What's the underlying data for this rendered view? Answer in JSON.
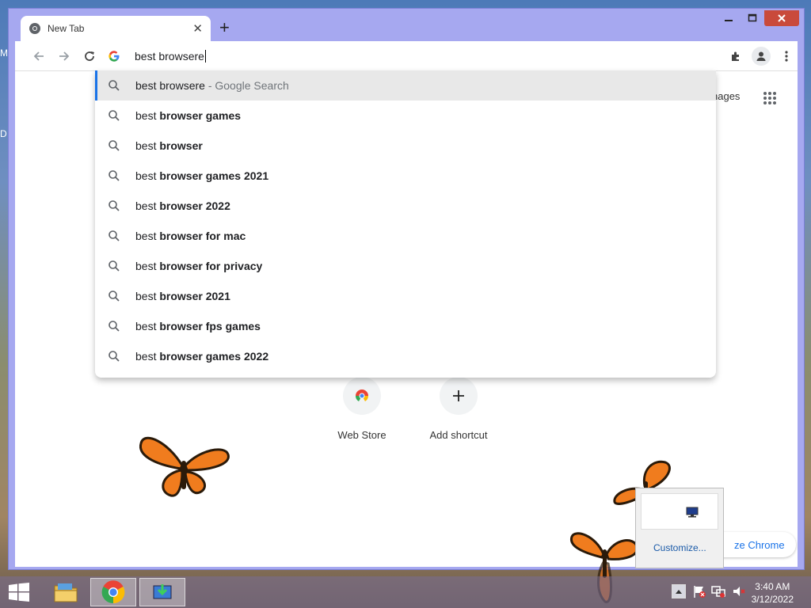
{
  "browser": {
    "tab": {
      "title": "New Tab"
    },
    "omnibox": {
      "value": "best browsere"
    },
    "suggestions": [
      {
        "prefix": "best browsere",
        "bold": "",
        "secondary": " - Google Search"
      },
      {
        "prefix": "best ",
        "bold": "browser games",
        "secondary": ""
      },
      {
        "prefix": "best ",
        "bold": "browser",
        "secondary": ""
      },
      {
        "prefix": "best ",
        "bold": "browser games 2021",
        "secondary": ""
      },
      {
        "prefix": "best ",
        "bold": "browser 2022",
        "secondary": ""
      },
      {
        "prefix": "best ",
        "bold": "browser for mac",
        "secondary": ""
      },
      {
        "prefix": "best ",
        "bold": "browser for privacy",
        "secondary": ""
      },
      {
        "prefix": "best ",
        "bold": "browser 2021",
        "secondary": ""
      },
      {
        "prefix": "best ",
        "bold": "browser fps games",
        "secondary": ""
      },
      {
        "prefix": "best ",
        "bold": "browser games 2022",
        "secondary": ""
      }
    ]
  },
  "page": {
    "images_link": "nages",
    "shortcuts": [
      {
        "label": "Web Store"
      },
      {
        "label": "Add shortcut"
      }
    ],
    "customize_chrome": "ze Chrome"
  },
  "tray_popup": {
    "link": "Customize..."
  },
  "taskbar": {
    "time": "3:40 AM",
    "date": "3/12/2022"
  },
  "desktop": {
    "edge_labels": [
      "M",
      "D"
    ]
  },
  "colors": {
    "accent": "#1a73e8",
    "close_button": "#c94a3b",
    "frame": "#a6a8f0"
  }
}
